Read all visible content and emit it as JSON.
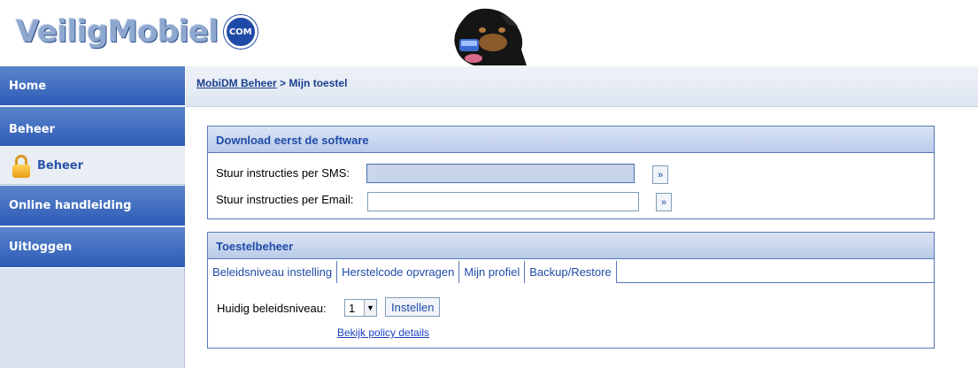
{
  "header": {
    "logo_text": "VeiligMobiel",
    "logo_badge": "COM"
  },
  "sidebar": {
    "items": [
      {
        "label": "Home"
      },
      {
        "label": "Beheer"
      },
      {
        "label": "Beheer",
        "icon": "lock-icon"
      },
      {
        "label": "Online handleiding"
      },
      {
        "label": "Uitloggen"
      }
    ]
  },
  "breadcrumb": {
    "parent": "MobiDM Beheer",
    "separator": ">",
    "current": "Mijn toestel"
  },
  "download_panel": {
    "title": "Download eerst de software",
    "sms_label": "Stuur instructies per SMS:",
    "sms_value": "",
    "email_label": "Stuur instructies per Email:",
    "email_value": "",
    "go_label": "»"
  },
  "device_panel": {
    "title": "Toestelbeheer",
    "tabs": [
      {
        "label": "Beleidsniveau instelling"
      },
      {
        "label": "Herstelcode opvragen"
      },
      {
        "label": "Mijn profiel"
      },
      {
        "label": "Backup/Restore"
      }
    ],
    "level_label": "Huidig beleidsniveau:",
    "level_value": "1",
    "set_button": "Instellen",
    "policy_link": "Bekijk policy details"
  },
  "colors": {
    "nav_blue": "#2e5cb6",
    "link_blue": "#1a3f8f",
    "panel_border": "#5578b8"
  }
}
